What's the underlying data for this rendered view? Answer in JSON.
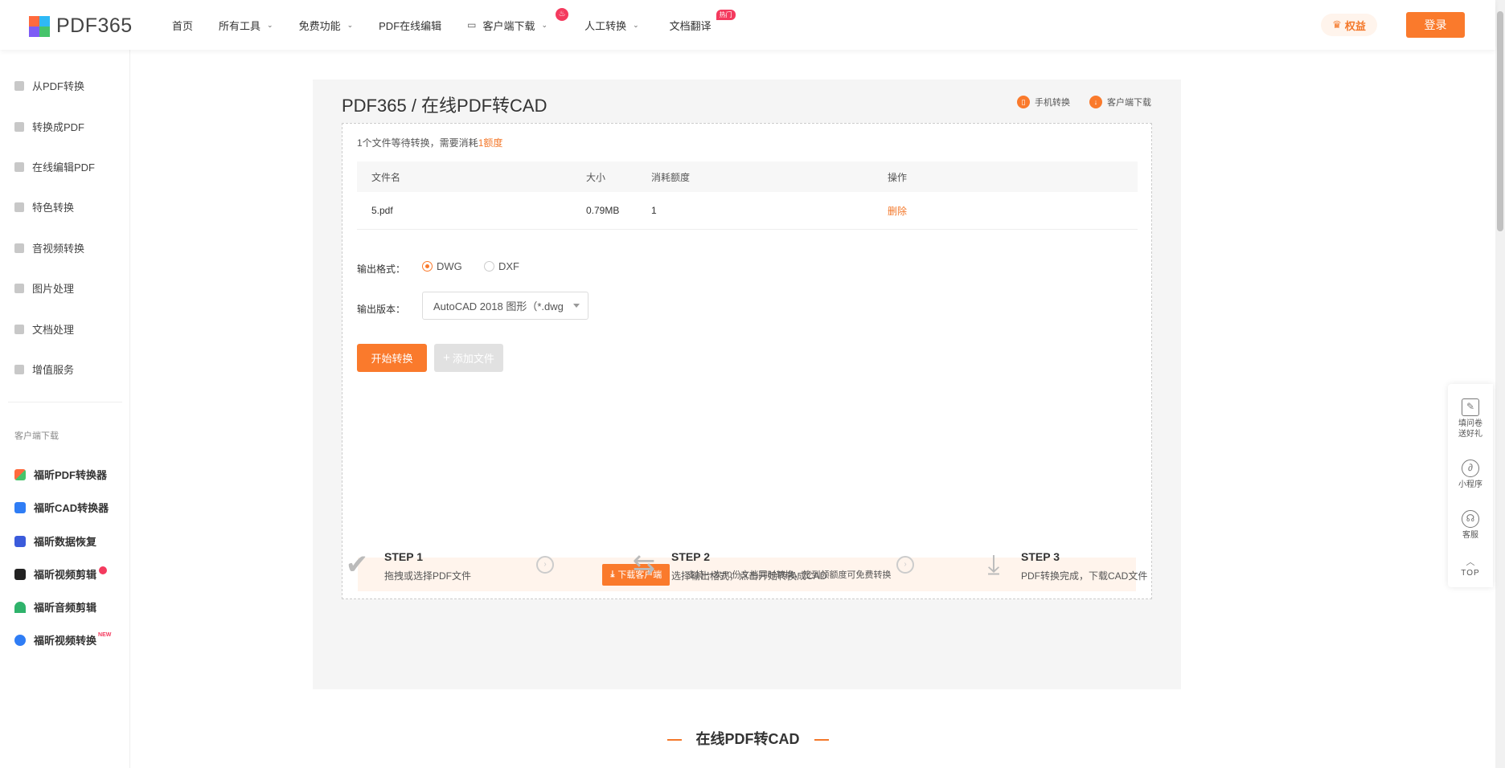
{
  "brand": {
    "name": "PDF365"
  },
  "nav": {
    "items": [
      {
        "label": "首页"
      },
      {
        "label": "所有工具"
      },
      {
        "label": "免费功能"
      },
      {
        "label": "PDF在线编辑"
      },
      {
        "label": "客户端下载"
      },
      {
        "label": "人工转换"
      },
      {
        "label": "文档翻译",
        "badge": "热门"
      }
    ],
    "rights_label": "权益",
    "login_label": "登录"
  },
  "sidebar": {
    "items": [
      {
        "label": "从PDF转换"
      },
      {
        "label": "转换成PDF"
      },
      {
        "label": "在线编辑PDF"
      },
      {
        "label": "特色转换"
      },
      {
        "label": "音视频转换"
      },
      {
        "label": "图片处理"
      },
      {
        "label": "文档处理"
      },
      {
        "label": "增值服务"
      }
    ],
    "download_heading": "客户端下载",
    "apps": [
      {
        "label": "福昕PDF转换器",
        "color": "#f4782a"
      },
      {
        "label": "福昕CAD转换器",
        "color": "#2f7df5"
      },
      {
        "label": "福昕数据恢复",
        "color": "#3b5bdb"
      },
      {
        "label": "福昕视频剪辑",
        "color": "#f4782a"
      },
      {
        "label": "福昕音频剪辑",
        "color": "#2fb36b"
      },
      {
        "label": "福昕视频转换",
        "color": "#2f7df5",
        "badge": "NEW"
      }
    ]
  },
  "main": {
    "title": "PDF365 / 在线PDF转CAD",
    "mobile_label": "手机转换",
    "client_label": "客户端下载",
    "status_prefix": "1个文件等待转换，需要消耗",
    "status_amount": "1额度",
    "table": {
      "headers": [
        "文件名",
        "大小",
        "消耗额度",
        "操作"
      ],
      "rows": [
        {
          "name": "5.pdf",
          "size": "0.79MB",
          "cost": "1",
          "action": "删除"
        }
      ]
    },
    "format_label": "输出格式：",
    "formats": [
      {
        "label": "DWG",
        "selected": true
      },
      {
        "label": "DXF",
        "selected": false
      }
    ],
    "version_label": "输出版本：",
    "version_value": "AutoCAD 2018 图形（*.dwg",
    "start_label": "开始转换",
    "add_label": "添加文件",
    "download_btn": "下载客户端",
    "download_tip": "支持一次50份文档同时转换，签到领额度可免费转换"
  },
  "steps": [
    {
      "title": "STEP 1",
      "desc": "拖拽或选择PDF文件"
    },
    {
      "title": "STEP 2",
      "desc": "选择输出格式，点击开始转换成CAD"
    },
    {
      "title": "STEP 3",
      "desc": "PDF转换完成，下载CAD文件"
    }
  ],
  "section_title": "在线PDF转CAD",
  "float_bar": {
    "survey": "填问卷送好礼",
    "miniprogram": "小程序",
    "service": "客服",
    "top": "TOP"
  },
  "colors": {
    "accent": "#fa7a2c",
    "hot": "#f43a5e"
  }
}
